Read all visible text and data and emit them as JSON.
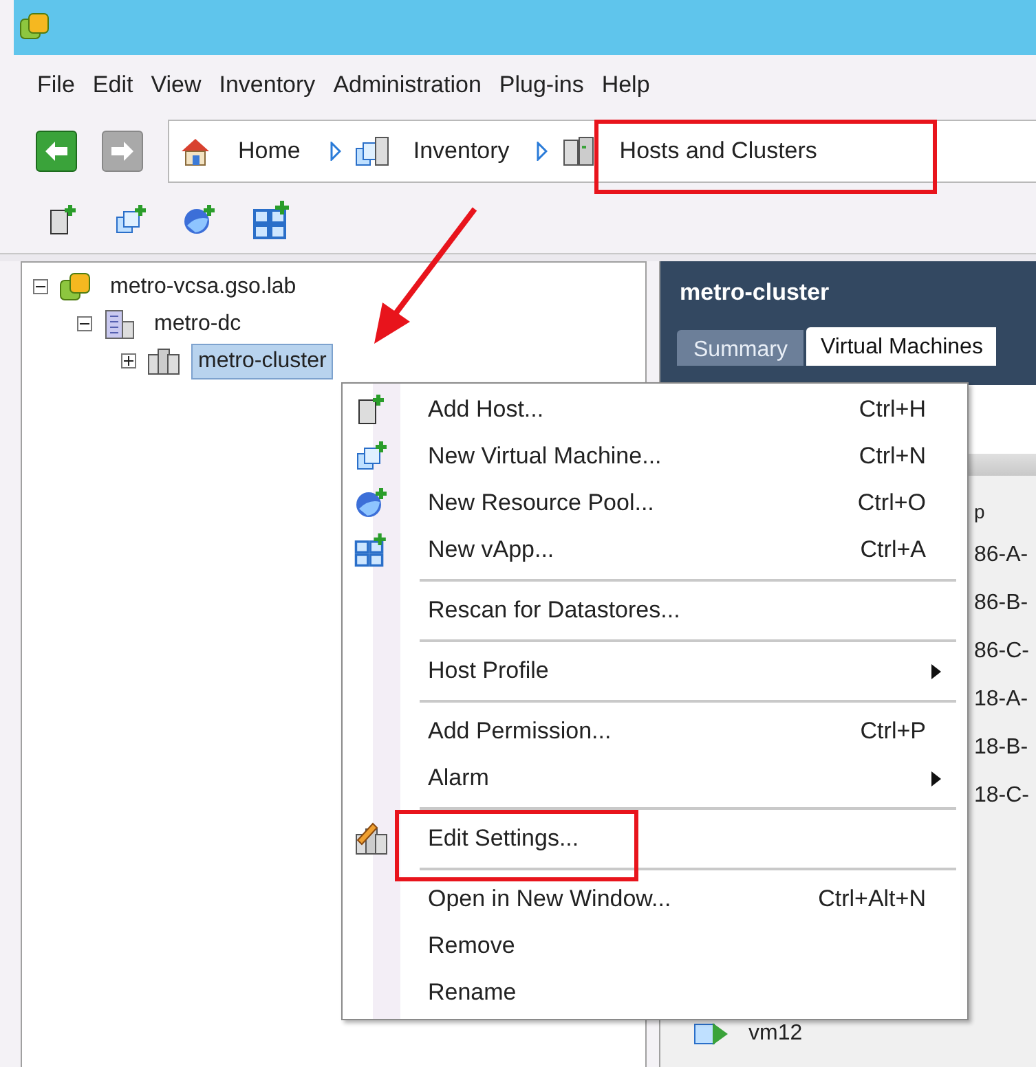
{
  "menu_bar": [
    "File",
    "Edit",
    "View",
    "Inventory",
    "Administration",
    "Plug-ins",
    "Help"
  ],
  "breadcrumb": [
    {
      "label": "Home"
    },
    {
      "label": "Inventory"
    },
    {
      "label": "Hosts and Clusters"
    }
  ],
  "tree": [
    {
      "label": "metro-vcsa.gso.lab",
      "expanded": true,
      "selected": false,
      "children": [
        {
          "label": "metro-dc",
          "expanded": true,
          "selected": false,
          "children": [
            {
              "label": "metro-cluster",
              "expanded": false,
              "selected": true
            }
          ]
        }
      ]
    }
  ],
  "detail": {
    "title": "metro-cluster",
    "tabs": [
      {
        "label": "Summary",
        "selected": false
      },
      {
        "label": "Virtual Machines",
        "selected": true
      }
    ],
    "list_header": "p",
    "rows": [
      "86-A-",
      "86-B-",
      "86-C-",
      "18-A-",
      "18-B-",
      "18-C-"
    ],
    "vm_row": "vm12"
  },
  "context_menu": [
    {
      "kind": "item",
      "label": "Add Host...",
      "shortcut": "Ctrl+H"
    },
    {
      "kind": "item",
      "label": "New Virtual Machine...",
      "shortcut": "Ctrl+N"
    },
    {
      "kind": "item",
      "label": "New Resource Pool...",
      "shortcut": "Ctrl+O"
    },
    {
      "kind": "item",
      "label": "New vApp...",
      "shortcut": "Ctrl+A"
    },
    {
      "kind": "separator"
    },
    {
      "kind": "item",
      "label": "Rescan for Datastores..."
    },
    {
      "kind": "separator"
    },
    {
      "kind": "item",
      "label": "Host Profile",
      "submenu": true
    },
    {
      "kind": "separator"
    },
    {
      "kind": "item",
      "label": "Add Permission...",
      "shortcut": "Ctrl+P"
    },
    {
      "kind": "item",
      "label": "Alarm",
      "submenu": true
    },
    {
      "kind": "separator"
    },
    {
      "kind": "item",
      "label": "Edit Settings..."
    },
    {
      "kind": "separator"
    },
    {
      "kind": "item",
      "label": "Open in New Window...",
      "shortcut": "Ctrl+Alt+N"
    },
    {
      "kind": "item",
      "label": "Remove"
    },
    {
      "kind": "item",
      "label": "Rename"
    }
  ]
}
